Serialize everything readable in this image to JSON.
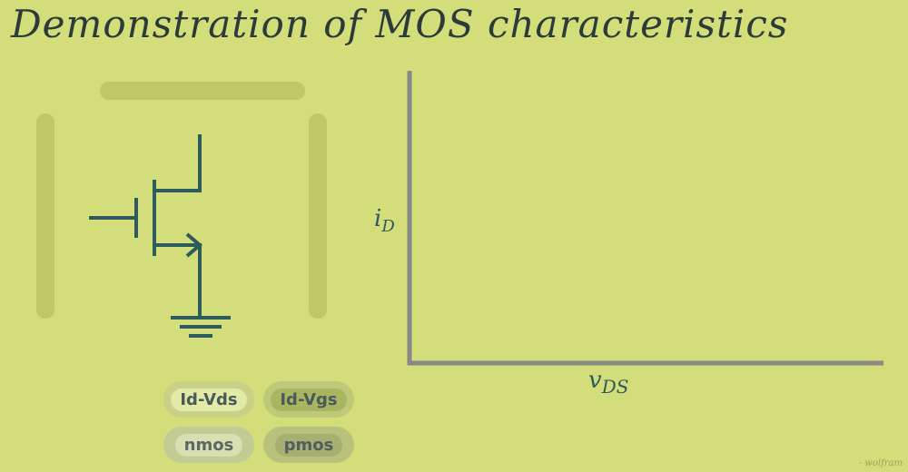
{
  "title": "Demonstration of MOS characteristics",
  "axes": {
    "ylabel_main": "i",
    "ylabel_sub": "D",
    "xlabel_main": "v",
    "xlabel_sub": "DS"
  },
  "buttons": {
    "id_vds": "Id-Vds",
    "id_vgs": "Id-Vgs",
    "nmos": "nmos",
    "pmos": "pmos"
  },
  "credit": "- wolfram",
  "colors": {
    "background": "#d3dd79",
    "circuit": "#2d5a5a",
    "axis": "#888888"
  }
}
